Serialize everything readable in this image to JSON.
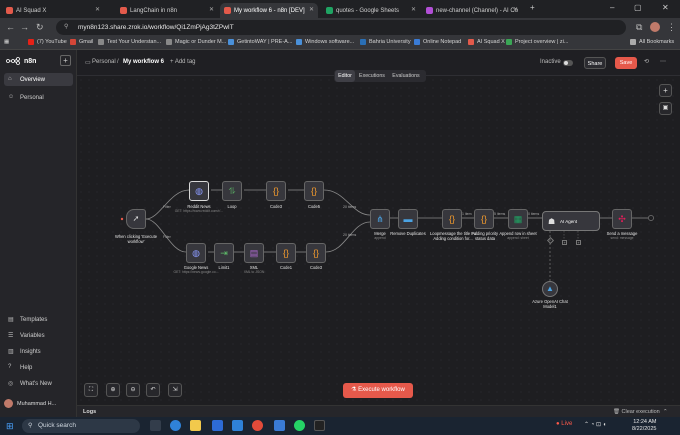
{
  "browser": {
    "tabs": [
      {
        "title": "AI Squad X",
        "color": "#e35a4b"
      },
      {
        "title": "LangChain in n8n",
        "color": "#e35a4b"
      },
      {
        "title": "My workflow 6 - n8n [DEV]",
        "color": "#e35a4b"
      },
      {
        "title": "quotes - Google Sheets",
        "color": "#1fa463"
      },
      {
        "title": "new-channel (Channel) - AI Co",
        "color": "#b24fd6"
      }
    ],
    "url": "myn8n123.share.zrok.io/workflow/Qi1ZmPjAg3tZPwIT",
    "bookmarks": [
      {
        "label": "(7) YouTube",
        "color": "#e62117"
      },
      {
        "label": "Gmail",
        "color": "#d44638"
      },
      {
        "label": "Test Your Understan...",
        "color": "#888"
      },
      {
        "label": "Magic or Dunder M...",
        "color": "#888"
      },
      {
        "label": "GetintoWAY | PRE-A...",
        "color": "#4a90d9"
      },
      {
        "label": "Windows software...",
        "color": "#4a90d9"
      },
      {
        "label": "Bahria University",
        "color": "#2a6fb5"
      },
      {
        "label": "Online Notepad",
        "color": "#3a7bd5"
      },
      {
        "label": "AI Squad X",
        "color": "#e35a4b"
      },
      {
        "label": "Project overview | zi...",
        "color": "#3aa655"
      }
    ],
    "all_bookmarks": "All Bookmarks"
  },
  "app": {
    "brand": "n8n",
    "sidebar": {
      "items": [
        {
          "label": "Overview",
          "icon": "home-icon"
        },
        {
          "label": "Personal",
          "icon": "user-icon"
        }
      ],
      "bottom_items": [
        {
          "label": "Templates"
        },
        {
          "label": "Variables"
        },
        {
          "label": "Insights"
        },
        {
          "label": "Help"
        },
        {
          "label": "What's New"
        }
      ],
      "user": "Muhammad H..."
    },
    "header": {
      "project": "Personal",
      "separator": "/",
      "workflow_name": "My workflow 6",
      "add_tag": "+ Add tag",
      "status": "Inactive",
      "share": "Share",
      "save": "Save"
    },
    "view_tabs": [
      "Editor",
      "Executions",
      "Evaluations"
    ],
    "execute_button": "Execute workflow",
    "logs_label": "Logs",
    "clear_execution": "Clear execution",
    "colors": {
      "accent": "#e6594b",
      "node_bg": "#37373d"
    }
  },
  "workflow": {
    "trigger": "When clicking 'Execute workflow'",
    "branch_labels": [
      "Filter",
      "Filter"
    ],
    "top_nodes": [
      {
        "label": "Reddit News",
        "sub": "GET: https://www.reddit.com/r/..."
      },
      {
        "label": "Loop"
      },
      {
        "label": "Code3"
      },
      {
        "label": "Code5"
      }
    ],
    "bottom_nodes": [
      {
        "label": "Google News",
        "sub": "GET: https://news.google.co..."
      },
      {
        "label": "Limit1"
      },
      {
        "label": "XML",
        "sub": "XML to JSON"
      },
      {
        "label": "Code1"
      },
      {
        "label": "Code3"
      }
    ],
    "main_nodes": [
      {
        "label": "Merge",
        "sub": "append"
      },
      {
        "label": "Remove Duplicates"
      },
      {
        "label": "Loopmessage the title Fo Adding condition for..."
      },
      {
        "label": "Adding priority status data"
      },
      {
        "label": "Append row in sheet",
        "sub": "append: sheet"
      },
      {
        "label": "AI Agent"
      },
      {
        "label": "Send a message",
        "sub": "send: message"
      }
    ],
    "model_node": "Azure OpenAI Chat Model1",
    "item_counts": [
      "20 items",
      "20 items",
      "1 item",
      "5 items",
      "30 items"
    ]
  },
  "taskbar": {
    "search": "Quick search",
    "time": "12:24 AM",
    "date": "8/22/2025",
    "live": "Live"
  }
}
